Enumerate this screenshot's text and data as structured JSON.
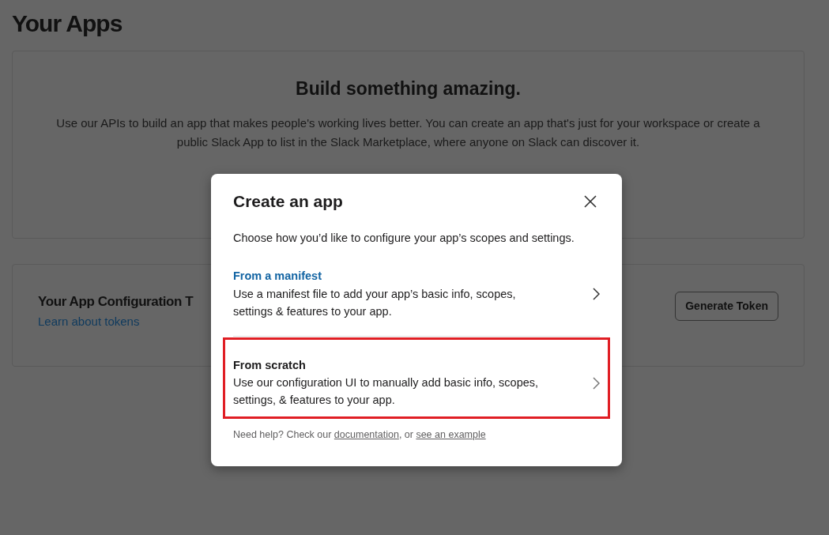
{
  "page": {
    "title": "Your Apps"
  },
  "intro_card": {
    "heading": "Build something amazing.",
    "text": "Use our APIs to build an app that makes people's working lives better. You can create an app that's just for your workspace or create a public Slack App to list in the Slack Marketplace, where anyone on Slack can discover it."
  },
  "token_card": {
    "title": "Your App Configuration T",
    "link": "Learn about tokens",
    "button": "Generate Token"
  },
  "modal": {
    "title": "Create an app",
    "subtitle": "Choose how you’d like to configure your app’s scopes and settings.",
    "options": [
      {
        "title": "From a manifest",
        "kind": "link",
        "description": "Use a manifest file to add your app’s basic info, scopes, settings & features to your app.",
        "highlighted": false
      },
      {
        "title": "From scratch",
        "kind": "plain",
        "description": "Use our configuration UI to manually add basic info, scopes, settings, & features to your app.",
        "highlighted": true
      }
    ],
    "help": {
      "text": "Need help? Check our",
      "link_1": "documentation",
      "separator": ", or",
      "link_2": "see an example"
    }
  }
}
